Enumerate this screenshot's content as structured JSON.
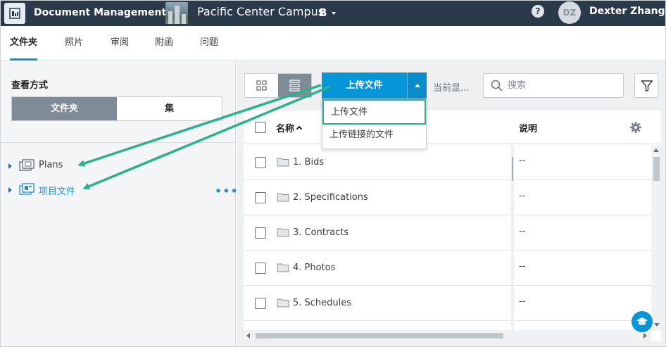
{
  "header": {
    "app_title": "Document Management",
    "project_title": "Pacific Center Campus",
    "project_badge": "B",
    "help_label": "?",
    "avatar_initials": "DZ",
    "user_name": "Dexter Zhang"
  },
  "tabs": [
    {
      "label": "文件夹",
      "active": true
    },
    {
      "label": "照片",
      "active": false
    },
    {
      "label": "审阅",
      "active": false
    },
    {
      "label": "附函",
      "active": false
    },
    {
      "label": "问题",
      "active": false
    }
  ],
  "sidebar": {
    "view_label": "查看方式",
    "segment_folder": "文件夹",
    "segment_set": "集",
    "tree": [
      {
        "label": "Plans",
        "icon": "plans-folder-icon",
        "color": "#3c3c3c"
      },
      {
        "label": "项目文件",
        "icon": "project-files-icon",
        "color": "#1f8fd0"
      }
    ],
    "more_label": "•••"
  },
  "toolbar": {
    "upload_label": "上传文件",
    "current_label": "当前显...",
    "search_placeholder": "搜索"
  },
  "dropdown": {
    "items": [
      "上传文件",
      "上传链接的文件"
    ]
  },
  "table": {
    "columns": {
      "name": "名称",
      "description": "说明"
    },
    "rows": [
      {
        "name": "1. Bids",
        "description": "--"
      },
      {
        "name": "2. Specifications",
        "description": "--"
      },
      {
        "name": "3. Contracts",
        "description": "--"
      },
      {
        "name": "4. Photos",
        "description": "--"
      },
      {
        "name": "5. Schedules",
        "description": "--"
      }
    ]
  },
  "colors": {
    "topbar": "#2b3a4a",
    "accent": "#0696d7",
    "annotation": "#2ab18d"
  }
}
